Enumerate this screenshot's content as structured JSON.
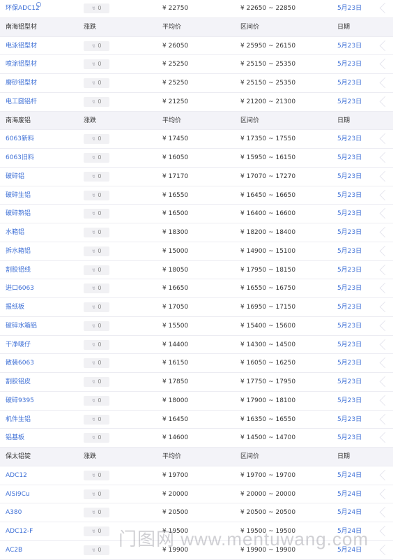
{
  "columns": {
    "change": "涨跌",
    "avg": "平均价",
    "range": "区间价",
    "date": "日期"
  },
  "sections": [
    {
      "title": "",
      "rows": [
        {
          "name": "环保ADC12",
          "change": "0",
          "avg": "¥ 22750",
          "range": "¥ 22650 ~ 22850",
          "date": "5月23日"
        }
      ]
    },
    {
      "title": "南海铝型材",
      "rows": [
        {
          "name": "电泳铝型材",
          "change": "0",
          "avg": "¥ 26050",
          "range": "¥ 25950 ~ 26150",
          "date": "5月23日"
        },
        {
          "name": "喷涂铝型材",
          "change": "0",
          "avg": "¥ 25250",
          "range": "¥ 25150 ~ 25350",
          "date": "5月23日"
        },
        {
          "name": "磨砂铝型材",
          "change": "0",
          "avg": "¥ 25250",
          "range": "¥ 25150 ~ 25350",
          "date": "5月23日"
        },
        {
          "name": "电工圆铝杆",
          "change": "0",
          "avg": "¥ 21250",
          "range": "¥ 21200 ~ 21300",
          "date": "5月23日"
        }
      ]
    },
    {
      "title": "南海废铝",
      "rows": [
        {
          "name": "6063新料",
          "change": "0",
          "avg": "¥ 17450",
          "range": "¥ 17350 ~ 17550",
          "date": "5月23日"
        },
        {
          "name": "6063旧料",
          "change": "0",
          "avg": "¥ 16050",
          "range": "¥ 15950 ~ 16150",
          "date": "5月23日"
        },
        {
          "name": "破碎铝",
          "change": "0",
          "avg": "¥ 17170",
          "range": "¥ 17070 ~ 17270",
          "date": "5月23日"
        },
        {
          "name": "破碎生铝",
          "change": "0",
          "avg": "¥ 16550",
          "range": "¥ 16450 ~ 16650",
          "date": "5月23日"
        },
        {
          "name": "破碎熟铝",
          "change": "0",
          "avg": "¥ 16500",
          "range": "¥ 16400 ~ 16600",
          "date": "5月23日"
        },
        {
          "name": "水箱铝",
          "change": "0",
          "avg": "¥ 18300",
          "range": "¥ 18200 ~ 18400",
          "date": "5月23日"
        },
        {
          "name": "拆水箱铝",
          "change": "0",
          "avg": "¥ 15000",
          "range": "¥ 14900 ~ 15100",
          "date": "5月23日"
        },
        {
          "name": "割胶铝线",
          "change": "0",
          "avg": "¥ 18050",
          "range": "¥ 17950 ~ 18150",
          "date": "5月23日"
        },
        {
          "name": "进口6063",
          "change": "0",
          "avg": "¥ 16650",
          "range": "¥ 16550 ~ 16750",
          "date": "5月23日"
        },
        {
          "name": "报纸板",
          "change": "0",
          "avg": "¥ 17050",
          "range": "¥ 16950 ~ 17150",
          "date": "5月23日"
        },
        {
          "name": "破碎水箱铝",
          "change": "0",
          "avg": "¥ 15500",
          "range": "¥ 15400 ~ 15600",
          "date": "5月23日"
        },
        {
          "name": "干净唛仔",
          "change": "0",
          "avg": "¥ 14400",
          "range": "¥ 14300 ~ 14500",
          "date": "5月23日"
        },
        {
          "name": "散装6063",
          "change": "0",
          "avg": "¥ 16150",
          "range": "¥ 16050 ~ 16250",
          "date": "5月23日"
        },
        {
          "name": "割胶铝皮",
          "change": "0",
          "avg": "¥ 17850",
          "range": "¥ 17750 ~ 17950",
          "date": "5月23日"
        },
        {
          "name": "破碎9395",
          "change": "0",
          "avg": "¥ 18000",
          "range": "¥ 17900 ~ 18100",
          "date": "5月23日"
        },
        {
          "name": "机件生铝",
          "change": "0",
          "avg": "¥ 16450",
          "range": "¥ 16350 ~ 16550",
          "date": "5月23日"
        },
        {
          "name": "铝基板",
          "change": "0",
          "avg": "¥ 14600",
          "range": "¥ 14500 ~ 14700",
          "date": "5月23日"
        }
      ]
    },
    {
      "title": "保太铝锭",
      "rows": [
        {
          "name": "ADC12",
          "change": "0",
          "avg": "¥ 19700",
          "range": "¥ 19700 ~ 19700",
          "date": "5月24日"
        },
        {
          "name": "AlSi9Cu",
          "change": "0",
          "avg": "¥ 20000",
          "range": "¥ 20000 ~ 20000",
          "date": "5月24日"
        },
        {
          "name": "A380",
          "change": "0",
          "avg": "¥ 20500",
          "range": "¥ 20500 ~ 20500",
          "date": "5月24日"
        },
        {
          "name": "ADC12-F",
          "change": "0",
          "avg": "¥ 19500",
          "range": "¥ 19500 ~ 19500",
          "date": "5月24日"
        },
        {
          "name": "AC2B",
          "change": "0",
          "avg": "¥ 19900",
          "range": "¥ 19900 ~ 19900",
          "date": "5月24日"
        }
      ]
    }
  ],
  "watermark": "门图网 www.mentuwang.com"
}
